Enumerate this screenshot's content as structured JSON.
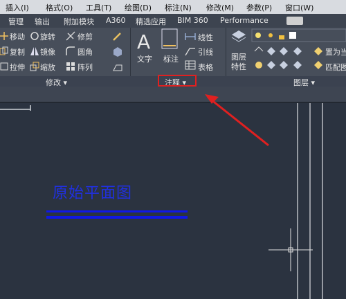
{
  "menubar": {
    "items": [
      "插入(I)",
      "格式(O)",
      "工具(T)",
      "绘图(D)",
      "标注(N)",
      "修改(M)",
      "参数(P)",
      "窗口(W)"
    ]
  },
  "tabs": [
    "管理",
    "输出",
    "附加模块",
    "A360",
    "精选应用",
    "BIM 360",
    "Performance"
  ],
  "ribbon": {
    "modify": {
      "move": "移动",
      "rotate": "旋转",
      "trim": "修剪",
      "copy": "复制",
      "mirror": "镜像",
      "fillet": "圆角",
      "stretch": "拉伸",
      "scale": "缩放",
      "array": "阵列",
      "panel_title": "修改"
    },
    "annotation": {
      "text": "文字",
      "dimension": "标注",
      "linear": "线性",
      "leader": "引线",
      "table": "表格",
      "panel_title": "注释"
    },
    "layers": {
      "layer_properties": "图层\n特性",
      "set_current": "置为当",
      "match": "匹配图",
      "panel_title": "图层"
    }
  },
  "drawing": {
    "title": "原始平面图"
  },
  "colors": {
    "accent_red": "#e02020",
    "drawing_blue": "#1018e6"
  }
}
